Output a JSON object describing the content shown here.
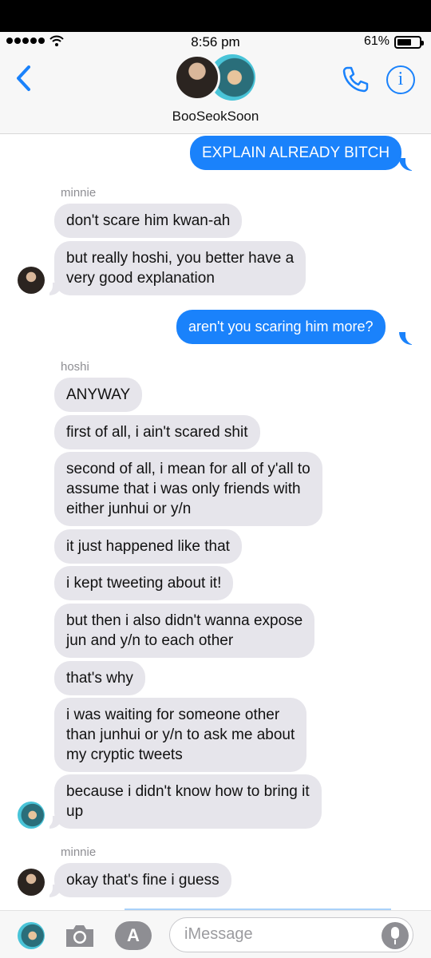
{
  "status_bar": {
    "time": "8:56 pm",
    "battery": "61%"
  },
  "header": {
    "chat_name": "BooSeokSoon"
  },
  "messages": [
    {
      "dir": "out",
      "text": "EXPLAIN ALREADY BITCH"
    },
    {
      "dir": "in",
      "sender": "minnie",
      "text": "don't scare him kwan-ah"
    },
    {
      "dir": "in",
      "lines": [
        "but really hoshi, you better have a",
        "very good explanation"
      ]
    },
    {
      "dir": "out",
      "text": "aren't you scaring him more?"
    },
    {
      "dir": "in",
      "sender": "hoshi",
      "text": "ANYWAY"
    },
    {
      "dir": "in",
      "text": "first of all, i ain't scared shit"
    },
    {
      "dir": "in",
      "lines": [
        "second of all, i mean for all of y'all to",
        "assume that i was only friends with",
        "either junhui or y/n"
      ]
    },
    {
      "dir": "in",
      "text": "it just happened like that"
    },
    {
      "dir": "in",
      "text": "i kept tweeting about it!"
    },
    {
      "dir": "in",
      "lines": [
        "but then i also didn't wanna expose",
        "jun and y/n to each other"
      ]
    },
    {
      "dir": "in",
      "text": "that's why"
    },
    {
      "dir": "in",
      "lines": [
        "i was waiting for someone other",
        "than junhui or y/n to ask me about",
        "my cryptic tweets"
      ]
    },
    {
      "dir": "in",
      "lines": [
        "because i didn't know how to bring it",
        "up"
      ]
    },
    {
      "dir": "in",
      "sender": "minnie",
      "text": "okay that's fine i guess"
    }
  ],
  "composer": {
    "placeholder": "iMessage",
    "appstore_glyph": "A"
  },
  "colors": {
    "accent": "#1a82fb",
    "incoming_bubble": "#e6e5eb"
  }
}
